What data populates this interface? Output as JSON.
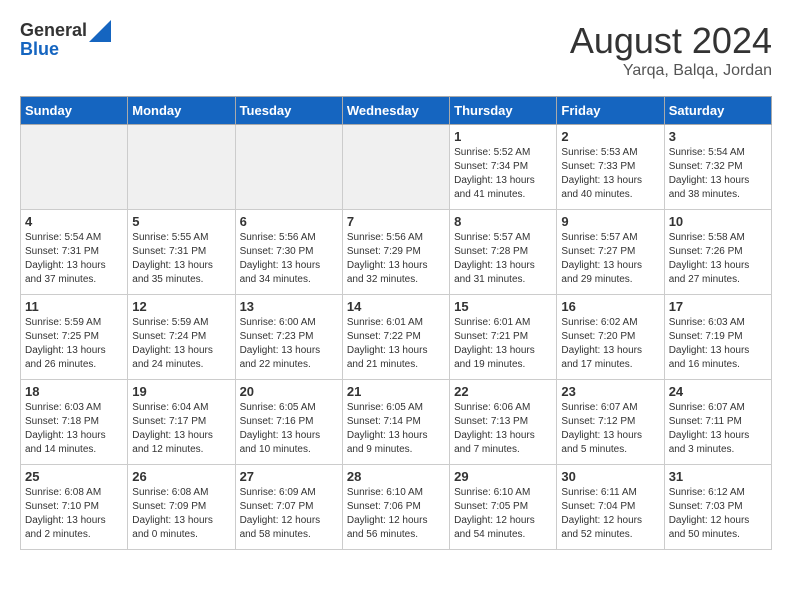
{
  "header": {
    "logo_general": "General",
    "logo_blue": "Blue",
    "month": "August 2024",
    "location": "Yarqa, Balqa, Jordan"
  },
  "weekdays": [
    "Sunday",
    "Monday",
    "Tuesday",
    "Wednesday",
    "Thursday",
    "Friday",
    "Saturday"
  ],
  "weeks": [
    [
      {
        "day": "",
        "empty": true
      },
      {
        "day": "",
        "empty": true
      },
      {
        "day": "",
        "empty": true
      },
      {
        "day": "",
        "empty": true
      },
      {
        "day": "1",
        "sunrise": "5:52 AM",
        "sunset": "7:34 PM",
        "daylight": "13 hours and 41 minutes."
      },
      {
        "day": "2",
        "sunrise": "5:53 AM",
        "sunset": "7:33 PM",
        "daylight": "13 hours and 40 minutes."
      },
      {
        "day": "3",
        "sunrise": "5:54 AM",
        "sunset": "7:32 PM",
        "daylight": "13 hours and 38 minutes."
      }
    ],
    [
      {
        "day": "4",
        "sunrise": "5:54 AM",
        "sunset": "7:31 PM",
        "daylight": "13 hours and 37 minutes."
      },
      {
        "day": "5",
        "sunrise": "5:55 AM",
        "sunset": "7:31 PM",
        "daylight": "13 hours and 35 minutes."
      },
      {
        "day": "6",
        "sunrise": "5:56 AM",
        "sunset": "7:30 PM",
        "daylight": "13 hours and 34 minutes."
      },
      {
        "day": "7",
        "sunrise": "5:56 AM",
        "sunset": "7:29 PM",
        "daylight": "13 hours and 32 minutes."
      },
      {
        "day": "8",
        "sunrise": "5:57 AM",
        "sunset": "7:28 PM",
        "daylight": "13 hours and 31 minutes."
      },
      {
        "day": "9",
        "sunrise": "5:57 AM",
        "sunset": "7:27 PM",
        "daylight": "13 hours and 29 minutes."
      },
      {
        "day": "10",
        "sunrise": "5:58 AM",
        "sunset": "7:26 PM",
        "daylight": "13 hours and 27 minutes."
      }
    ],
    [
      {
        "day": "11",
        "sunrise": "5:59 AM",
        "sunset": "7:25 PM",
        "daylight": "13 hours and 26 minutes."
      },
      {
        "day": "12",
        "sunrise": "5:59 AM",
        "sunset": "7:24 PM",
        "daylight": "13 hours and 24 minutes."
      },
      {
        "day": "13",
        "sunrise": "6:00 AM",
        "sunset": "7:23 PM",
        "daylight": "13 hours and 22 minutes."
      },
      {
        "day": "14",
        "sunrise": "6:01 AM",
        "sunset": "7:22 PM",
        "daylight": "13 hours and 21 minutes."
      },
      {
        "day": "15",
        "sunrise": "6:01 AM",
        "sunset": "7:21 PM",
        "daylight": "13 hours and 19 minutes."
      },
      {
        "day": "16",
        "sunrise": "6:02 AM",
        "sunset": "7:20 PM",
        "daylight": "13 hours and 17 minutes."
      },
      {
        "day": "17",
        "sunrise": "6:03 AM",
        "sunset": "7:19 PM",
        "daylight": "13 hours and 16 minutes."
      }
    ],
    [
      {
        "day": "18",
        "sunrise": "6:03 AM",
        "sunset": "7:18 PM",
        "daylight": "13 hours and 14 minutes."
      },
      {
        "day": "19",
        "sunrise": "6:04 AM",
        "sunset": "7:17 PM",
        "daylight": "13 hours and 12 minutes."
      },
      {
        "day": "20",
        "sunrise": "6:05 AM",
        "sunset": "7:16 PM",
        "daylight": "13 hours and 10 minutes."
      },
      {
        "day": "21",
        "sunrise": "6:05 AM",
        "sunset": "7:14 PM",
        "daylight": "13 hours and 9 minutes."
      },
      {
        "day": "22",
        "sunrise": "6:06 AM",
        "sunset": "7:13 PM",
        "daylight": "13 hours and 7 minutes."
      },
      {
        "day": "23",
        "sunrise": "6:07 AM",
        "sunset": "7:12 PM",
        "daylight": "13 hours and 5 minutes."
      },
      {
        "day": "24",
        "sunrise": "6:07 AM",
        "sunset": "7:11 PM",
        "daylight": "13 hours and 3 minutes."
      }
    ],
    [
      {
        "day": "25",
        "sunrise": "6:08 AM",
        "sunset": "7:10 PM",
        "daylight": "13 hours and 2 minutes."
      },
      {
        "day": "26",
        "sunrise": "6:08 AM",
        "sunset": "7:09 PM",
        "daylight": "13 hours and 0 minutes."
      },
      {
        "day": "27",
        "sunrise": "6:09 AM",
        "sunset": "7:07 PM",
        "daylight": "12 hours and 58 minutes."
      },
      {
        "day": "28",
        "sunrise": "6:10 AM",
        "sunset": "7:06 PM",
        "daylight": "12 hours and 56 minutes."
      },
      {
        "day": "29",
        "sunrise": "6:10 AM",
        "sunset": "7:05 PM",
        "daylight": "12 hours and 54 minutes."
      },
      {
        "day": "30",
        "sunrise": "6:11 AM",
        "sunset": "7:04 PM",
        "daylight": "12 hours and 52 minutes."
      },
      {
        "day": "31",
        "sunrise": "6:12 AM",
        "sunset": "7:03 PM",
        "daylight": "12 hours and 50 minutes."
      }
    ]
  ]
}
